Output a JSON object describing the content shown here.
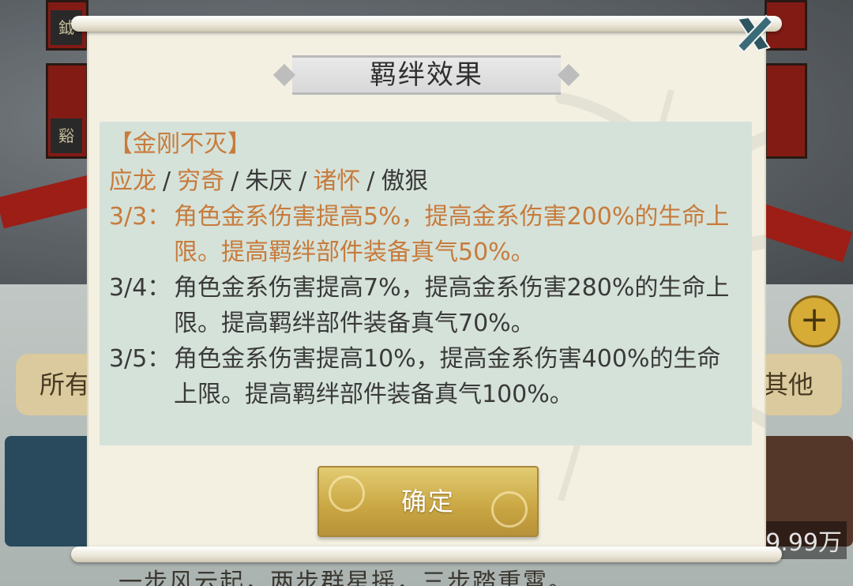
{
  "background": {
    "filter_left_label": "所有",
    "filter_right_label": "其他",
    "price_text": "9.99万",
    "flavor_text": "一步风云起，两步群星摇，三步踏重霄。",
    "card_plate_1": "鉞",
    "card_plate_2": "谿"
  },
  "dialog": {
    "title": "羁绊效果",
    "set_name": "【金刚不灭】",
    "members": [
      {
        "name": "应龙",
        "highlighted": true
      },
      {
        "name": "穷奇",
        "highlighted": true
      },
      {
        "name": "朱厌",
        "highlighted": false
      },
      {
        "name": "诸怀",
        "highlighted": true
      },
      {
        "name": "傲狠",
        "highlighted": false
      }
    ],
    "separator": "/",
    "effects": [
      {
        "tier": "3/3：",
        "desc": "角色金系伤害提高5%，提高金系伤害200%的生命上限。提高羁绊部件装备真气50%。",
        "active": true
      },
      {
        "tier": "3/4：",
        "desc": "角色金系伤害提高7%，提高金系伤害280%的生命上限。提高羁绊部件装备真气70%。",
        "active": false
      },
      {
        "tier": "3/5：",
        "desc": "角色金系伤害提高10%，提高金系伤害400%的生命上限。提高羁绊部件装备真气100%。",
        "active": false
      }
    ],
    "confirm_label": "确定",
    "close_icon": "close-x-icon"
  },
  "colors": {
    "highlight": "#c77b3c",
    "normal_text": "#3a3a3a",
    "content_bg": "#d5e2d9",
    "button_gold": "#c9a642"
  }
}
